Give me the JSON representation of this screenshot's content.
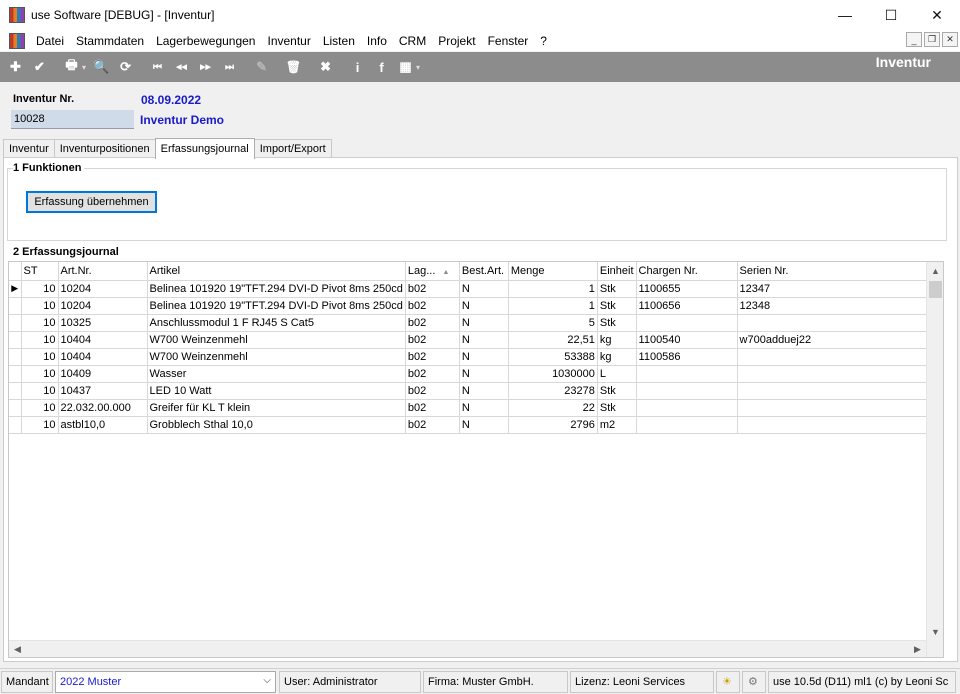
{
  "window": {
    "title": "use Software [DEBUG] - [Inventur]",
    "min_glyph": "—",
    "max_glyph": "☐",
    "close_glyph": "✕"
  },
  "menu": {
    "items": [
      "Datei",
      "Stammdaten",
      "Lagerbewegungen",
      "Inventur",
      "Listen",
      "Info",
      "CRM",
      "Projekt",
      "Fenster",
      "?"
    ],
    "mdi_min": "_",
    "mdi_restore": "❐",
    "mdi_close": "✕"
  },
  "toolbar": {
    "title": "Inventur",
    "icons": {
      "add": "✚",
      "confirm": "✔",
      "print": "🖶",
      "search": "🔍",
      "refresh": "⟳",
      "first": "⏮",
      "prev": "◀◀",
      "next": "▶▶",
      "last": "⏭",
      "edit": "✎",
      "delete": "🗑",
      "cancel": "✖",
      "info": "i",
      "form": "f",
      "grid": "▦",
      "dropdown": "▾"
    }
  },
  "header": {
    "inventur_label": "Inventur Nr.",
    "date": "08.09.2022",
    "number": "10028",
    "name": "Inventur Demo"
  },
  "tabs": [
    "Inventur",
    "Inventurpositionen",
    "Erfassungsjournal",
    "Import/Export"
  ],
  "active_tab": 2,
  "group1": {
    "title": "1 Funktionen",
    "button": "Erfassung übernehmen"
  },
  "group2": {
    "title": "2 Erfassungsjournal"
  },
  "grid": {
    "columns": [
      "ST",
      "Art.Nr.",
      "Artikel",
      "Lag...",
      "Best.Art.",
      "Menge",
      "Einheit",
      "Chargen Nr.",
      "Serien Nr."
    ],
    "sort_glyph": "▲",
    "row_indicator": "▶",
    "rows": [
      {
        "st": "10",
        "artnr": "10204",
        "artikel": "Belinea 101920 19\"TFT.294 DVI-D Pivot 8ms 250cd",
        "lag": "b02",
        "best": "N",
        "menge": "1",
        "einheit": "Stk",
        "charge": "1100655",
        "serie": "12347"
      },
      {
        "st": "10",
        "artnr": "10204",
        "artikel": "Belinea 101920 19\"TFT.294 DVI-D Pivot 8ms 250cd",
        "lag": "b02",
        "best": "N",
        "menge": "1",
        "einheit": "Stk",
        "charge": "1100656",
        "serie": "12348"
      },
      {
        "st": "10",
        "artnr": "10325",
        "artikel": "Anschlussmodul 1 F RJ45 S Cat5",
        "lag": "b02",
        "best": "N",
        "menge": "5",
        "einheit": "Stk",
        "charge": "",
        "serie": ""
      },
      {
        "st": "10",
        "artnr": "10404",
        "artikel": "W700 Weinzenmehl",
        "lag": "b02",
        "best": "N",
        "menge": "22,51",
        "einheit": "kg",
        "charge": "1100540",
        "serie": "w700adduej22"
      },
      {
        "st": "10",
        "artnr": "10404",
        "artikel": "W700 Weinzenmehl",
        "lag": "b02",
        "best": "N",
        "menge": "53388",
        "einheit": "kg",
        "charge": "1100586",
        "serie": ""
      },
      {
        "st": "10",
        "artnr": "10409",
        "artikel": "Wasser",
        "lag": "b02",
        "best": "N",
        "menge": "1030000",
        "einheit": "L",
        "charge": "",
        "serie": ""
      },
      {
        "st": "10",
        "artnr": "10437",
        "artikel": "LED 10 Watt",
        "lag": "b02",
        "best": "N",
        "menge": "23278",
        "einheit": "Stk",
        "charge": "",
        "serie": ""
      },
      {
        "st": "10",
        "artnr": "22.032.00.000",
        "artikel": "Greifer für KL T klein",
        "lag": "b02",
        "best": "N",
        "menge": "22",
        "einheit": "Stk",
        "charge": "",
        "serie": ""
      },
      {
        "st": "10",
        "artnr": "astbl10,0",
        "artikel": "Grobblech Sthal 10,0",
        "lag": "b02",
        "best": "N",
        "menge": "2796",
        "einheit": "m2",
        "charge": "",
        "serie": ""
      }
    ]
  },
  "statusbar": {
    "mandant_label": "Mandant",
    "mandant_value": "2022 Muster",
    "user": "User: Administrator",
    "firma": "Firma: Muster GmbH.",
    "lizenz": "Lizenz: Leoni Services",
    "version": "use 10.5d (D11) ml1 (c) by Leoni Sc",
    "icon1": "☀",
    "icon2": "⚙"
  }
}
